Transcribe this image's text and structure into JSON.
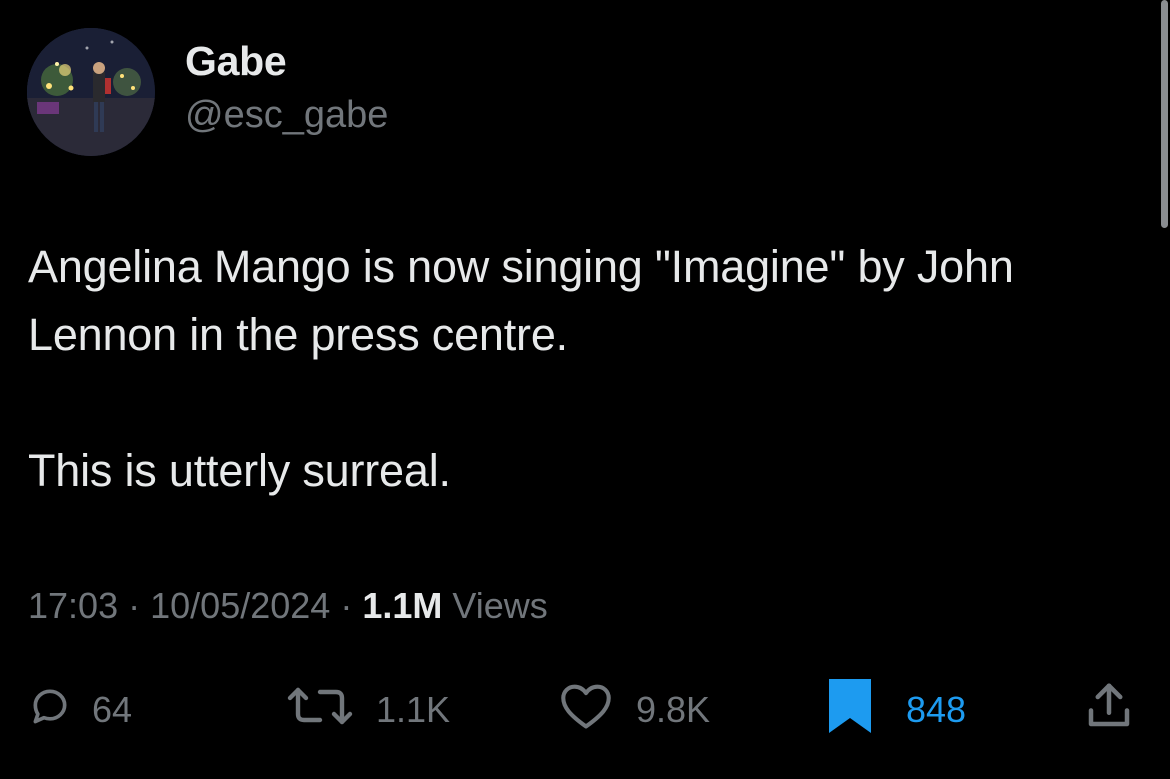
{
  "author": {
    "display_name": "Gabe",
    "handle": "@esc_gabe"
  },
  "tweet": {
    "text": "Angelina Mango is now singing \"Imagine\" by John\nLennon in the press centre.\n\nThis is utterly surreal."
  },
  "meta": {
    "time": "17:03",
    "separator": "·",
    "date": "10/05/2024",
    "views_count": "1.1M",
    "views_label": "Views"
  },
  "actions": {
    "replies": "64",
    "reposts": "1.1K",
    "likes": "9.8K",
    "bookmarks": "848"
  },
  "colors": {
    "background": "#000000",
    "text_primary": "#e7e9ea",
    "text_secondary": "#71767b",
    "accent_blue": "#1d9bf0"
  },
  "icons": {
    "reply": "reply-bubble-icon",
    "repost": "repost-arrows-icon",
    "like": "heart-icon",
    "bookmark": "bookmark-filled-icon",
    "share": "share-upload-icon"
  }
}
